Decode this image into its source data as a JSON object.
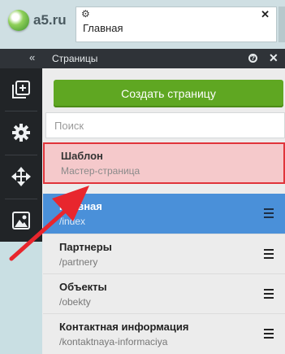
{
  "site": {
    "logo_text": "a5.ru"
  },
  "browser_tab": {
    "title": "Главная"
  },
  "panel": {
    "collapse_label": "«",
    "title": "Страницы",
    "help_label": "?",
    "close_label": "✕"
  },
  "toolbar": {
    "tools": [
      "add-page-icon",
      "gear-icon",
      "move-arrows-icon",
      "image-icon"
    ]
  },
  "create_button": {
    "label": "Создать страницу"
  },
  "search": {
    "placeholder": "Поиск",
    "value": ""
  },
  "pages": [
    {
      "name": "Шаблон",
      "path": "Мастер-страница",
      "state": "highlighted"
    },
    {
      "name": "Главная",
      "path": "/index",
      "state": "selected"
    },
    {
      "name": "Партнеры",
      "path": "/partnery",
      "state": "normal"
    },
    {
      "name": "Объекты",
      "path": "/obekty",
      "state": "normal"
    },
    {
      "name": "Контактная информация",
      "path": "/kontaktnaya-informaciya",
      "state": "normal"
    }
  ],
  "colors": {
    "accent_green": "#5fa722",
    "selected_blue": "#4a90d9",
    "highlight_red": "#e0343b",
    "arrow_red": "#e8262d"
  }
}
